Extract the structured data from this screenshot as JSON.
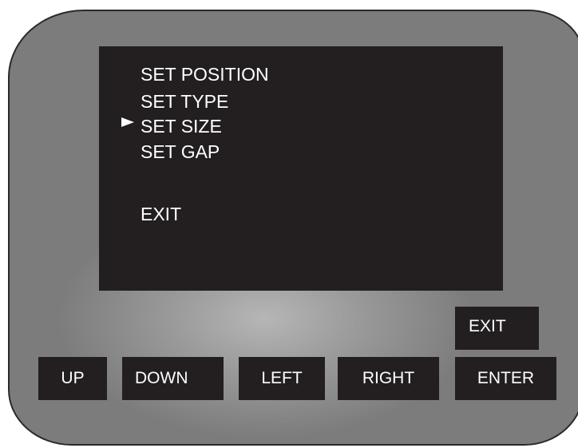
{
  "screen": {
    "menu": [
      {
        "label": "SET POSITION",
        "selected": false
      },
      {
        "label": "SET TYPE",
        "selected": false
      },
      {
        "label": "SET SIZE",
        "selected": true
      },
      {
        "label": "SET GAP",
        "selected": false
      },
      {
        "label": "EXIT",
        "selected": false
      }
    ],
    "pointer_icon": "right-triangle-pointer"
  },
  "buttons": {
    "exit": "EXIT",
    "up": "UP",
    "down": "DOWN",
    "left": "LEFT",
    "right": "RIGHT",
    "enter": "ENTER"
  },
  "colors": {
    "screen_bg": "#231f20",
    "button_bg": "#231f20",
    "text": "#ffffff",
    "bezel": "#8c8c8c"
  }
}
